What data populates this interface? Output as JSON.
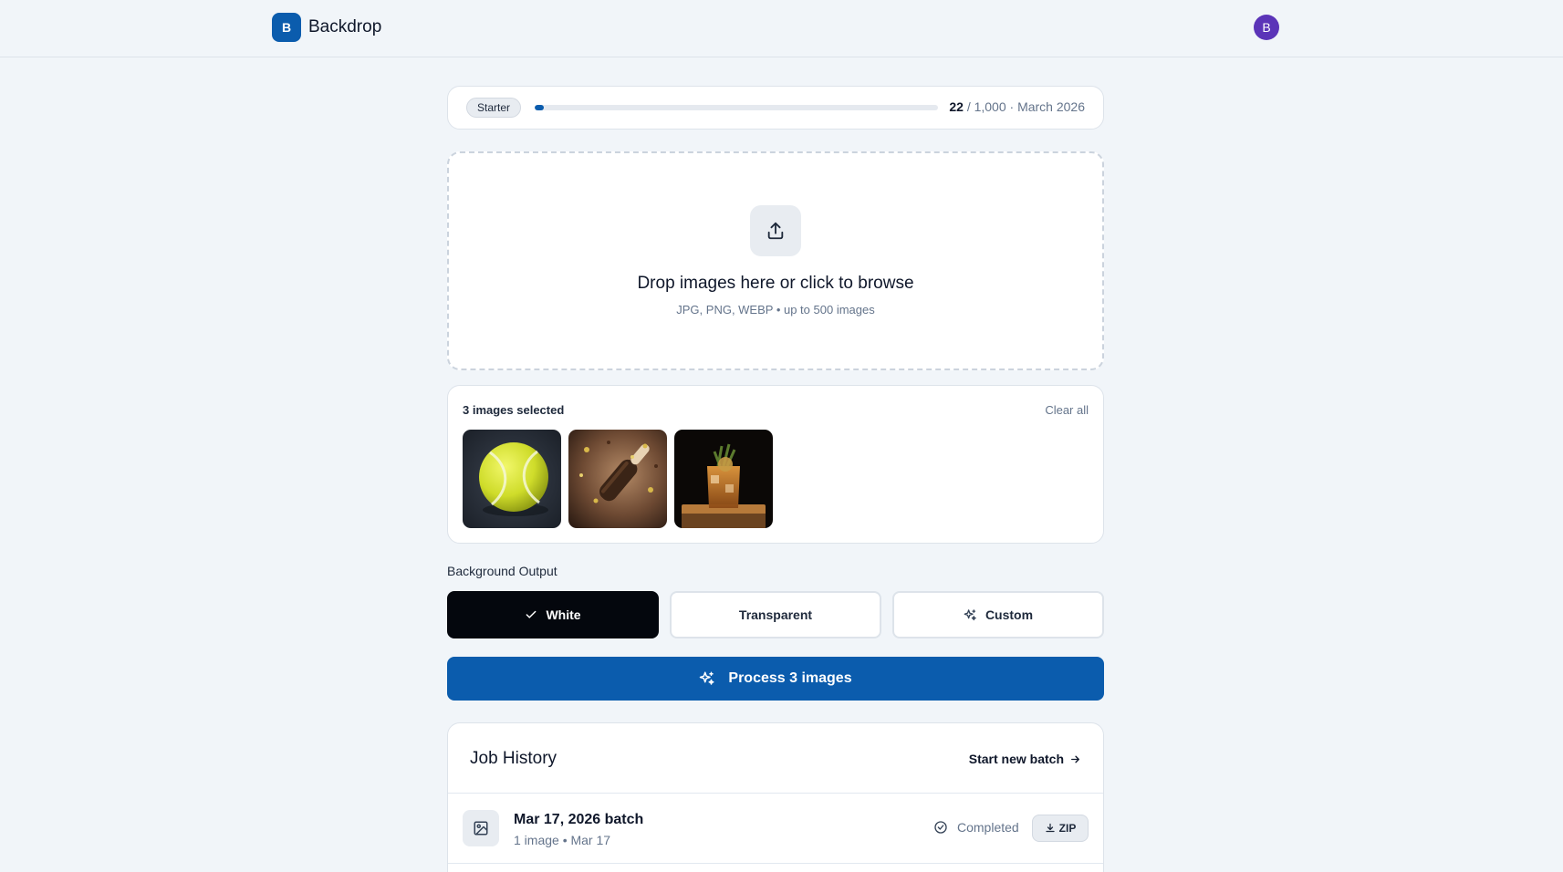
{
  "app": {
    "logo_letter": "B",
    "name": "Backdrop",
    "avatar_letter": "B"
  },
  "usage": {
    "plan": "Starter",
    "used": "22",
    "rest": "/ 1,000 · March 2026",
    "fraction": 0.022,
    "accent": "#0b5cad"
  },
  "dropzone": {
    "icon": "upload-icon",
    "title": "Drop images here or click to browse",
    "subtitle": "JPG, PNG, WEBP • up to 500 images"
  },
  "selection": {
    "title": "3 images selected",
    "clear_label": "Clear all",
    "thumbnails": [
      "tennis ball",
      "chocolate ice cream bar",
      "cocktail glass"
    ]
  },
  "background_output": {
    "label": "Background Output",
    "options": [
      {
        "label": "White",
        "icon": "check-icon",
        "selected": true
      },
      {
        "label": "Transparent",
        "selected": false
      },
      {
        "label": "Custom",
        "icon": "sparkle-icon",
        "selected": false
      }
    ]
  },
  "process_button": {
    "label": "Process 3 images",
    "icon": "sparkle-icon"
  },
  "history": {
    "title": "Job History",
    "new_batch_label": "Start new batch",
    "jobs": [
      {
        "name": "Mar 17, 2026 batch",
        "meta": "1 image • Mar 17",
        "status": "Completed",
        "download_label": "ZIP"
      }
    ]
  }
}
